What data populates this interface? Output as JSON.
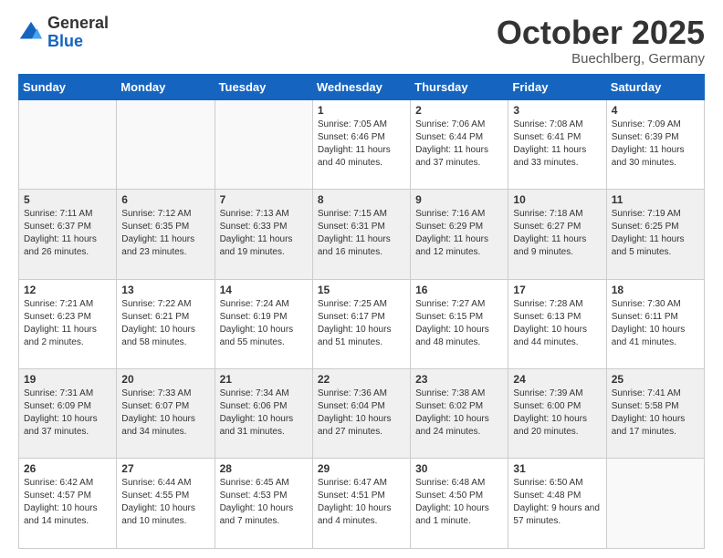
{
  "header": {
    "logo_general": "General",
    "logo_blue": "Blue",
    "month": "October 2025",
    "location": "Buechlberg, Germany"
  },
  "weekdays": [
    "Sunday",
    "Monday",
    "Tuesday",
    "Wednesday",
    "Thursday",
    "Friday",
    "Saturday"
  ],
  "weeks": [
    [
      {
        "day": "",
        "info": ""
      },
      {
        "day": "",
        "info": ""
      },
      {
        "day": "",
        "info": ""
      },
      {
        "day": "1",
        "info": "Sunrise: 7:05 AM\nSunset: 6:46 PM\nDaylight: 11 hours and 40 minutes."
      },
      {
        "day": "2",
        "info": "Sunrise: 7:06 AM\nSunset: 6:44 PM\nDaylight: 11 hours and 37 minutes."
      },
      {
        "day": "3",
        "info": "Sunrise: 7:08 AM\nSunset: 6:41 PM\nDaylight: 11 hours and 33 minutes."
      },
      {
        "day": "4",
        "info": "Sunrise: 7:09 AM\nSunset: 6:39 PM\nDaylight: 11 hours and 30 minutes."
      }
    ],
    [
      {
        "day": "5",
        "info": "Sunrise: 7:11 AM\nSunset: 6:37 PM\nDaylight: 11 hours and 26 minutes."
      },
      {
        "day": "6",
        "info": "Sunrise: 7:12 AM\nSunset: 6:35 PM\nDaylight: 11 hours and 23 minutes."
      },
      {
        "day": "7",
        "info": "Sunrise: 7:13 AM\nSunset: 6:33 PM\nDaylight: 11 hours and 19 minutes."
      },
      {
        "day": "8",
        "info": "Sunrise: 7:15 AM\nSunset: 6:31 PM\nDaylight: 11 hours and 16 minutes."
      },
      {
        "day": "9",
        "info": "Sunrise: 7:16 AM\nSunset: 6:29 PM\nDaylight: 11 hours and 12 minutes."
      },
      {
        "day": "10",
        "info": "Sunrise: 7:18 AM\nSunset: 6:27 PM\nDaylight: 11 hours and 9 minutes."
      },
      {
        "day": "11",
        "info": "Sunrise: 7:19 AM\nSunset: 6:25 PM\nDaylight: 11 hours and 5 minutes."
      }
    ],
    [
      {
        "day": "12",
        "info": "Sunrise: 7:21 AM\nSunset: 6:23 PM\nDaylight: 11 hours and 2 minutes."
      },
      {
        "day": "13",
        "info": "Sunrise: 7:22 AM\nSunset: 6:21 PM\nDaylight: 10 hours and 58 minutes."
      },
      {
        "day": "14",
        "info": "Sunrise: 7:24 AM\nSunset: 6:19 PM\nDaylight: 10 hours and 55 minutes."
      },
      {
        "day": "15",
        "info": "Sunrise: 7:25 AM\nSunset: 6:17 PM\nDaylight: 10 hours and 51 minutes."
      },
      {
        "day": "16",
        "info": "Sunrise: 7:27 AM\nSunset: 6:15 PM\nDaylight: 10 hours and 48 minutes."
      },
      {
        "day": "17",
        "info": "Sunrise: 7:28 AM\nSunset: 6:13 PM\nDaylight: 10 hours and 44 minutes."
      },
      {
        "day": "18",
        "info": "Sunrise: 7:30 AM\nSunset: 6:11 PM\nDaylight: 10 hours and 41 minutes."
      }
    ],
    [
      {
        "day": "19",
        "info": "Sunrise: 7:31 AM\nSunset: 6:09 PM\nDaylight: 10 hours and 37 minutes."
      },
      {
        "day": "20",
        "info": "Sunrise: 7:33 AM\nSunset: 6:07 PM\nDaylight: 10 hours and 34 minutes."
      },
      {
        "day": "21",
        "info": "Sunrise: 7:34 AM\nSunset: 6:06 PM\nDaylight: 10 hours and 31 minutes."
      },
      {
        "day": "22",
        "info": "Sunrise: 7:36 AM\nSunset: 6:04 PM\nDaylight: 10 hours and 27 minutes."
      },
      {
        "day": "23",
        "info": "Sunrise: 7:38 AM\nSunset: 6:02 PM\nDaylight: 10 hours and 24 minutes."
      },
      {
        "day": "24",
        "info": "Sunrise: 7:39 AM\nSunset: 6:00 PM\nDaylight: 10 hours and 20 minutes."
      },
      {
        "day": "25",
        "info": "Sunrise: 7:41 AM\nSunset: 5:58 PM\nDaylight: 10 hours and 17 minutes."
      }
    ],
    [
      {
        "day": "26",
        "info": "Sunrise: 6:42 AM\nSunset: 4:57 PM\nDaylight: 10 hours and 14 minutes."
      },
      {
        "day": "27",
        "info": "Sunrise: 6:44 AM\nSunset: 4:55 PM\nDaylight: 10 hours and 10 minutes."
      },
      {
        "day": "28",
        "info": "Sunrise: 6:45 AM\nSunset: 4:53 PM\nDaylight: 10 hours and 7 minutes."
      },
      {
        "day": "29",
        "info": "Sunrise: 6:47 AM\nSunset: 4:51 PM\nDaylight: 10 hours and 4 minutes."
      },
      {
        "day": "30",
        "info": "Sunrise: 6:48 AM\nSunset: 4:50 PM\nDaylight: 10 hours and 1 minute."
      },
      {
        "day": "31",
        "info": "Sunrise: 6:50 AM\nSunset: 4:48 PM\nDaylight: 9 hours and 57 minutes."
      },
      {
        "day": "",
        "info": ""
      }
    ]
  ]
}
